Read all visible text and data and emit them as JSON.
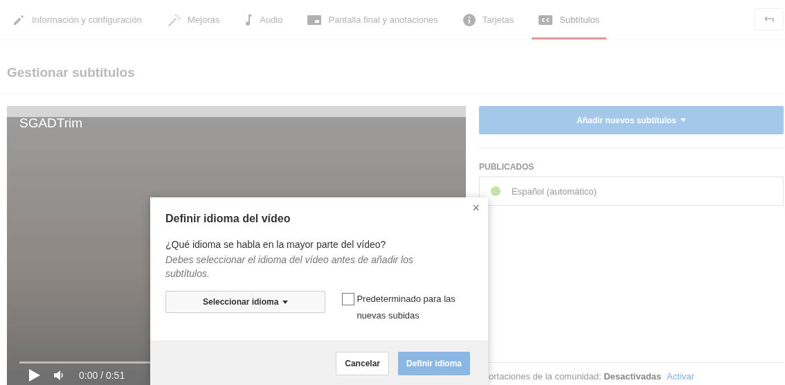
{
  "tabs": [
    {
      "label": "Información y configuración",
      "kind": "pencil",
      "selected": false
    },
    {
      "label": "Mejoras",
      "kind": "wand",
      "selected": false
    },
    {
      "label": "Audio",
      "kind": "note",
      "selected": false
    },
    {
      "label": "Pantalla final y anotaciones",
      "kind": "screen",
      "selected": false
    },
    {
      "label": "Tarjetas",
      "kind": "info",
      "selected": false
    },
    {
      "label": "Subtítulos",
      "kind": "cc",
      "selected": true
    }
  ],
  "heading": "Gestionar subtítulos",
  "video": {
    "title": "SGADTrim",
    "time": "0:00 / 0:51"
  },
  "side": {
    "add_button": "Añadir nuevos subtítulos",
    "section_label": "PUBLICADOS",
    "tracks": [
      {
        "name": "Español (automático)",
        "color": "#c5e1a5"
      }
    ],
    "community": {
      "text": "ortaciones de la comunidad: ",
      "state": "Desactivadas",
      "link": "Activar"
    }
  },
  "dialog": {
    "title": "Definir idioma del vídeo",
    "question": "¿Qué idioma se habla en la mayor parte del vídeo?",
    "hint": "Debes seleccionar el idioma del vídeo antes de añadir los subtítulos.",
    "select": "Seleccionar idioma",
    "default_checkbox": {
      "label": "Predeterminado para las nuevas subidas",
      "checked": false
    },
    "close": "×",
    "cancel": "Cancelar",
    "confirm": "Definir idioma"
  }
}
